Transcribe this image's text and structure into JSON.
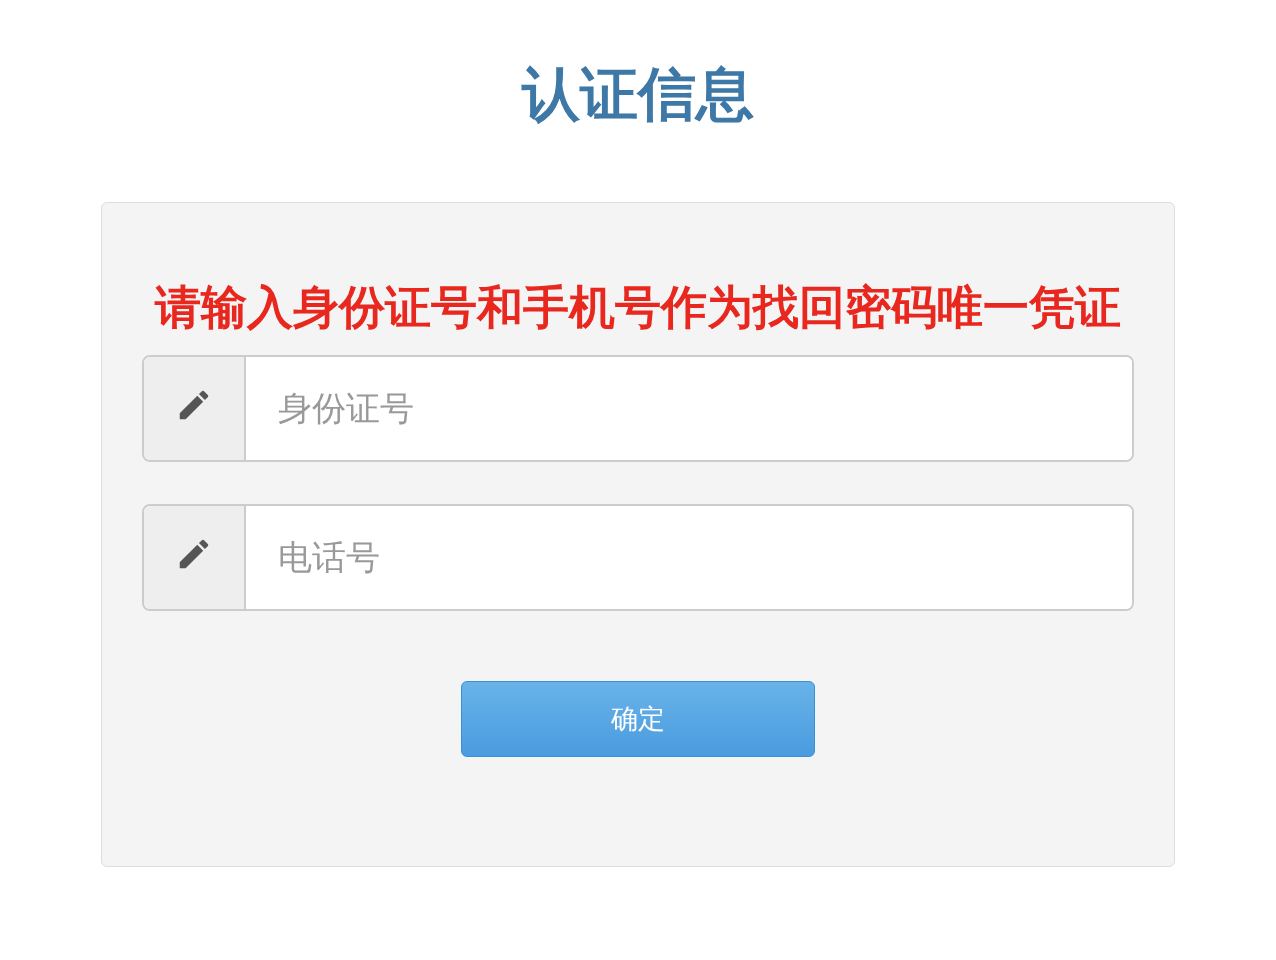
{
  "title": "认证信息",
  "notice": "请输入身份证号和手机号作为找回密码唯一凭证",
  "fields": [
    {
      "placeholder": "身份证号"
    },
    {
      "placeholder": "电话号"
    }
  ],
  "button": "确定"
}
